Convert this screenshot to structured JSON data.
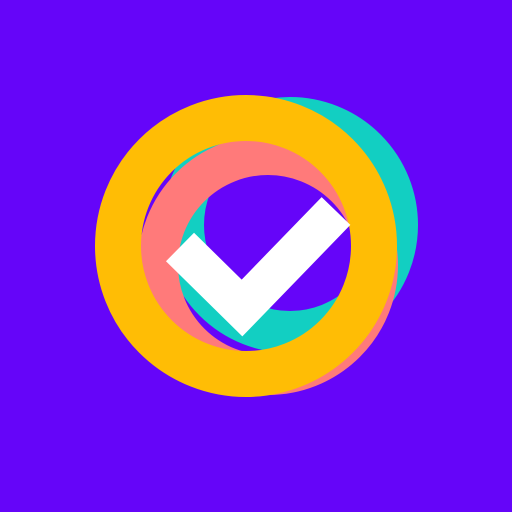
{
  "icon": {
    "name": "app-icon-checkmark-rings",
    "colors": {
      "background": "#6505F9",
      "ring_teal": "#12CFC2",
      "ring_coral": "#FF7A7A",
      "ring_yellow": "#FFBD05",
      "checkmark": "#FFFFFF"
    },
    "elements": [
      "teal-ring",
      "coral-ring",
      "yellow-ring",
      "checkmark"
    ]
  }
}
